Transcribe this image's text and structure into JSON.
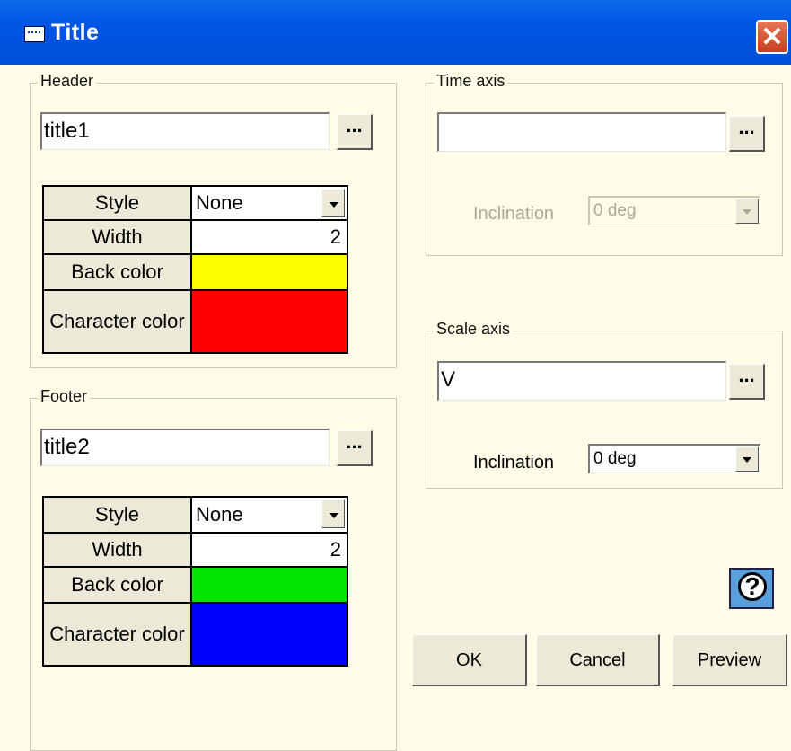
{
  "window": {
    "title": "Title"
  },
  "header": {
    "group_label": "Header",
    "text": "title1",
    "browse_label": "...",
    "rows": [
      {
        "label": "Style",
        "value": "None"
      },
      {
        "label": "Width",
        "value": "2"
      },
      {
        "label": "Back color",
        "value": "",
        "color": "#ffff00"
      },
      {
        "label": "Character color",
        "value": "",
        "color": "#ff0000"
      }
    ]
  },
  "footer": {
    "group_label": "Footer",
    "text": "title2",
    "browse_label": "...",
    "rows": [
      {
        "label": "Style",
        "value": "None"
      },
      {
        "label": "Width",
        "value": "2"
      },
      {
        "label": "Back color",
        "value": "",
        "color": "#00e400"
      },
      {
        "label": "Character color",
        "value": "",
        "color": "#0000ff"
      }
    ]
  },
  "time_axis": {
    "group_label": "Time axis",
    "text": "",
    "browse_label": "...",
    "inclination_label": "Inclination",
    "inclination_value": "0 deg",
    "enabled": false
  },
  "scale_axis": {
    "group_label": "Scale axis",
    "text": "V",
    "browse_label": "...",
    "inclination_label": "Inclination",
    "inclination_value": "0 deg",
    "enabled": true
  },
  "buttons": {
    "ok": "OK",
    "cancel": "Cancel",
    "preview": "Preview"
  },
  "icons": {
    "window": "dialog-icon",
    "close": "close-icon",
    "help": "help-icon"
  }
}
